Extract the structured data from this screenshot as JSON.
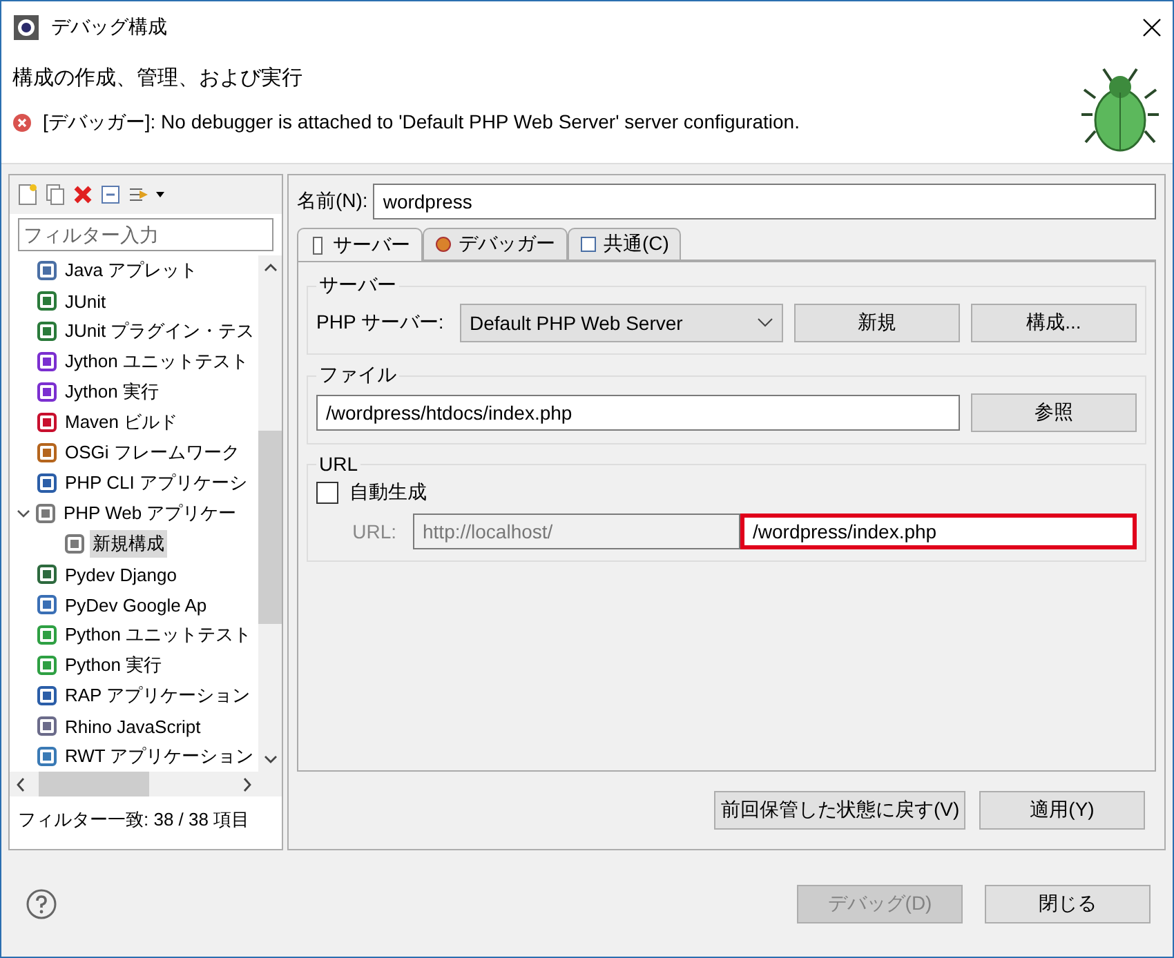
{
  "window": {
    "title": "デバッグ構成"
  },
  "header": {
    "title": "構成の作成、管理、および実行",
    "message": "[デバッガー]: No debugger is attached to 'Default PHP Web Server' server configuration."
  },
  "sidebar": {
    "filter_placeholder": "フィルター入力",
    "items": [
      {
        "label": "Java アプレット",
        "selected": false
      },
      {
        "label": "JUnit",
        "selected": false
      },
      {
        "label": "JUnit プラグイン・テス",
        "selected": false
      },
      {
        "label": "Jython ユニットテスト",
        "selected": false
      },
      {
        "label": "Jython 実行",
        "selected": false
      },
      {
        "label": "Maven ビルド",
        "selected": false
      },
      {
        "label": "OSGi フレームワーク",
        "selected": false
      },
      {
        "label": "PHP CLI アプリケーシ",
        "selected": false
      },
      {
        "label": "PHP Web アプリケー",
        "selected": false,
        "expanded": true,
        "children": [
          {
            "label": "新規構成",
            "selected": true
          }
        ]
      },
      {
        "label": "Pydev Django",
        "selected": false
      },
      {
        "label": "PyDev Google Ap",
        "selected": false
      },
      {
        "label": "Python ユニットテスト",
        "selected": false
      },
      {
        "label": "Python 実行",
        "selected": false
      },
      {
        "label": "RAP アプリケーション",
        "selected": false
      },
      {
        "label": "Rhino JavaScript",
        "selected": false
      },
      {
        "label": "RWT アプリケーション",
        "selected": false
      }
    ],
    "status": "フィルター一致: 38 / 38 項目"
  },
  "name": {
    "label": "名前(N):",
    "value": "wordpress"
  },
  "tabs": [
    {
      "label": "サーバー",
      "selected": true
    },
    {
      "label": "デバッガー",
      "selected": false
    },
    {
      "label": "共通(C)",
      "selected": false
    }
  ],
  "server_group": {
    "title": "サーバー",
    "label": "PHP サーバー:",
    "value": "Default PHP Web Server",
    "buttons": [
      "新規",
      "構成..."
    ]
  },
  "file_group": {
    "title": "ファイル",
    "value": "/wordpress/htdocs/index.php",
    "button": "参照"
  },
  "url_group": {
    "title": "URL",
    "auto_label": "自動生成",
    "auto_checked": false,
    "url_label": "URL:",
    "disabled": true,
    "base": "http://localhost/",
    "path": "/wordpress/index.php",
    "highlighted": true
  },
  "panel_buttons": [
    {
      "label": "前回保管した状態に戻す(V)",
      "disabled": false
    },
    {
      "label": "適用(Y)",
      "disabled": false
    }
  ],
  "footer_buttons": [
    {
      "label": "デバッグ(D)",
      "disabled": true
    },
    {
      "label": "閉じる",
      "disabled": false
    }
  ]
}
